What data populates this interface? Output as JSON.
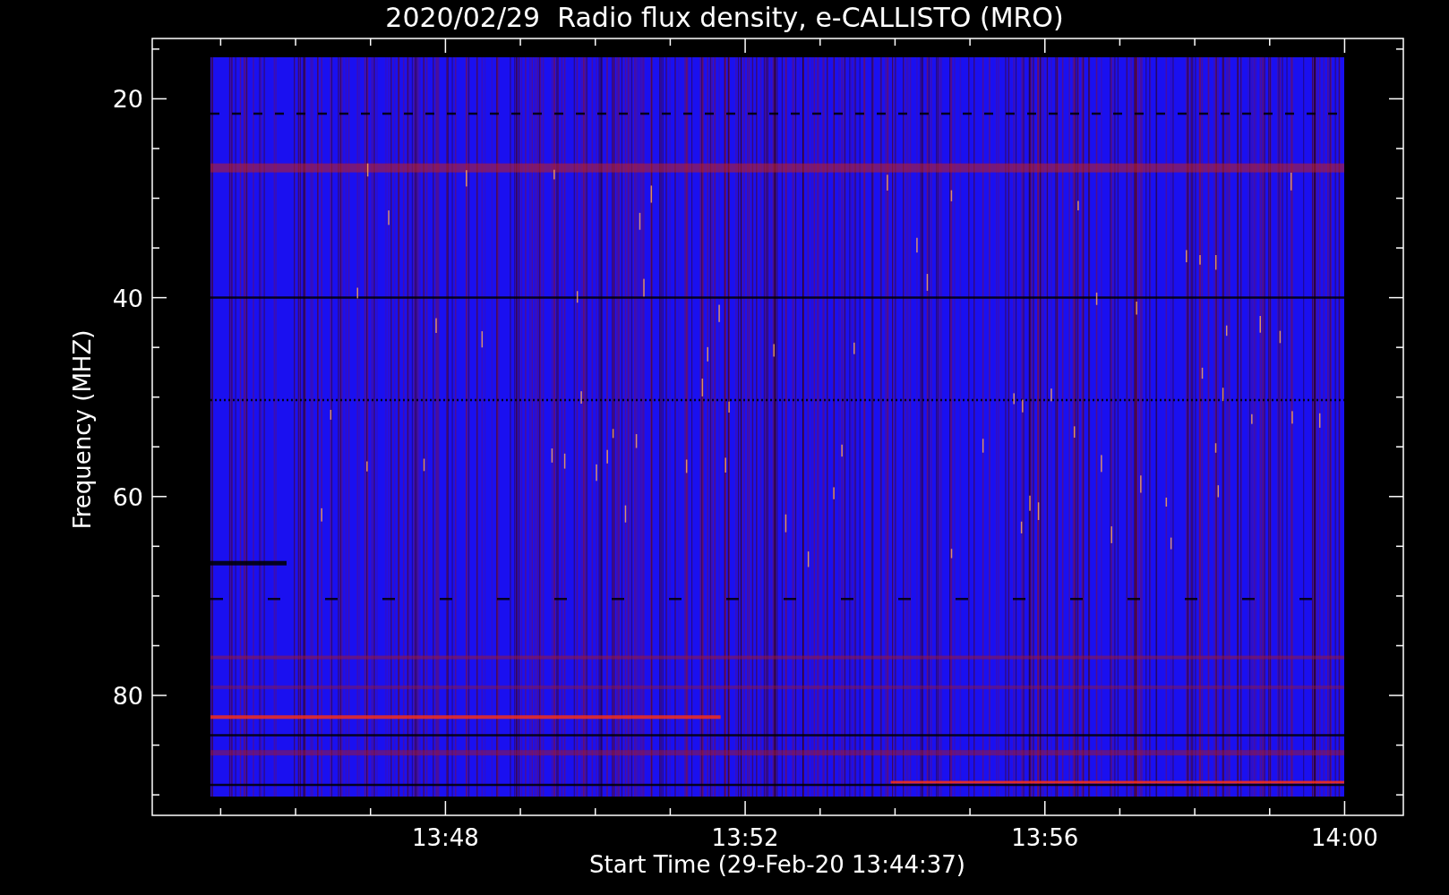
{
  "plot": {
    "title": "2020/02/29  Radio flux density, e-CALLISTO (MRO)",
    "ylabel": "Frequency (MHZ)",
    "xlabel": "Start Time (29-Feb-20 13:44:37)",
    "yticks": [
      "20",
      "40",
      "60",
      "80"
    ],
    "xticks": [
      "13:48",
      "13:52",
      "13:56",
      "14:00"
    ]
  }
}
